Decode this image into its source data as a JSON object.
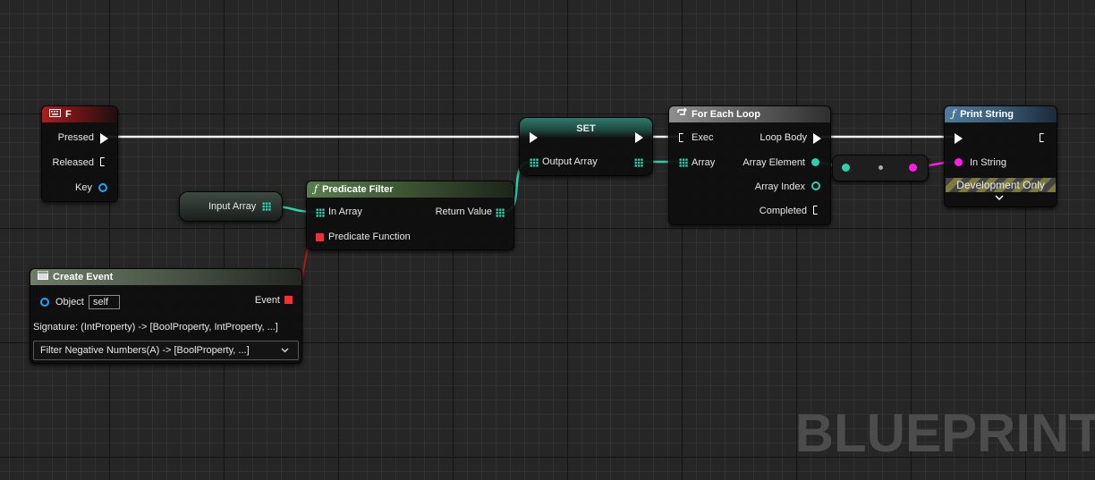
{
  "watermark": "BLUEPRINT",
  "key_node": {
    "title": "F",
    "pins": {
      "pressed": "Pressed",
      "released": "Released",
      "key": "Key"
    }
  },
  "input_array_node": {
    "label": "Input Array"
  },
  "predicate_filter": {
    "title": "Predicate Filter",
    "pins": {
      "in_array": "In Array",
      "return_value": "Return Value",
      "predicate_function": "Predicate Function"
    }
  },
  "create_event": {
    "title": "Create Event",
    "object_label": "Object",
    "object_value": "self",
    "event_label": "Event",
    "signature": "Signature: (IntProperty) -> [BoolProperty, IntProperty, ...]",
    "selected_function": "Filter Negative Numbers(A) -> [BoolProperty, ...]"
  },
  "set_node": {
    "title": "SET",
    "pins": {
      "output_array": "Output Array"
    }
  },
  "for_each_loop": {
    "title": "For Each Loop",
    "pins": {
      "exec": "Exec",
      "loop_body": "Loop Body",
      "array": "Array",
      "array_element": "Array Element",
      "array_index": "Array Index",
      "completed": "Completed"
    }
  },
  "print_string": {
    "title": "Print String",
    "pins": {
      "in_string": "In String"
    },
    "footer": "Development Only"
  },
  "colors": {
    "exec": "#ffffff",
    "array": "#2ad1aa",
    "string": "#ff1ce8",
    "object": "#1aa7ff",
    "delegate": "#ff2e2e"
  }
}
